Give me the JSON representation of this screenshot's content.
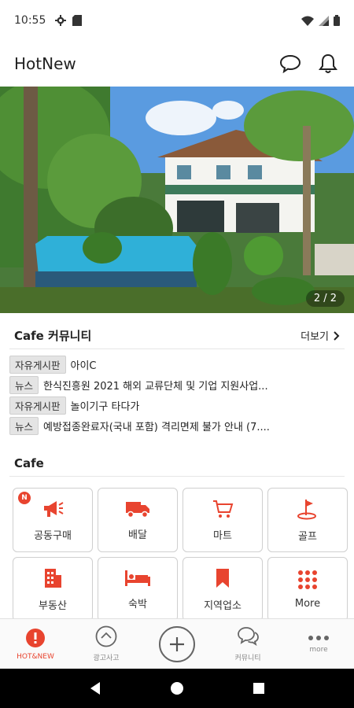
{
  "status_bar": {
    "time": "10:55"
  },
  "header": {
    "title": "HotNew"
  },
  "banner": {
    "counter": "2 / 2"
  },
  "community": {
    "title": "Cafe 커뮤니티",
    "more_label": "더보기",
    "posts": [
      {
        "tag": "자유게시판",
        "title": "아이C"
      },
      {
        "tag": "뉴스",
        "title": "한식진흥원 2021 해외 교류단체 및 기업 지원사업..."
      },
      {
        "tag": "자유게시판",
        "title": "놀이기구 타다가"
      },
      {
        "tag": "뉴스",
        "title": "예방접종완료자(국내 포함) 격리면제 불가 안내 (7...."
      }
    ]
  },
  "cafe": {
    "title": "Cafe",
    "tiles": [
      {
        "label": "공동구매",
        "icon": "megaphone-icon",
        "badge": "N"
      },
      {
        "label": "배달",
        "icon": "truck-icon"
      },
      {
        "label": "마트",
        "icon": "cart-icon"
      },
      {
        "label": "골프",
        "icon": "golf-flag-icon"
      },
      {
        "label": "부동산",
        "icon": "building-icon"
      },
      {
        "label": "숙박",
        "icon": "bed-icon"
      },
      {
        "label": "지역업소",
        "icon": "bookmark-icon"
      },
      {
        "label": "More",
        "icon": "grid-dots-icon"
      }
    ]
  },
  "bottom_nav": {
    "items": [
      {
        "label": "HOT&NEW",
        "icon": "alert-circle-icon",
        "active": true
      },
      {
        "label": "광고사고",
        "icon": "chevron-up-circle-icon"
      },
      {
        "label": "",
        "icon": "add-circle-icon"
      },
      {
        "label": "커뮤니티",
        "icon": "chat-bubbles-icon"
      },
      {
        "label": "more",
        "icon": "more-dots-icon"
      }
    ]
  },
  "colors": {
    "accent": "#e8442f",
    "text": "#222222",
    "nav_bg": "#fafafa"
  }
}
